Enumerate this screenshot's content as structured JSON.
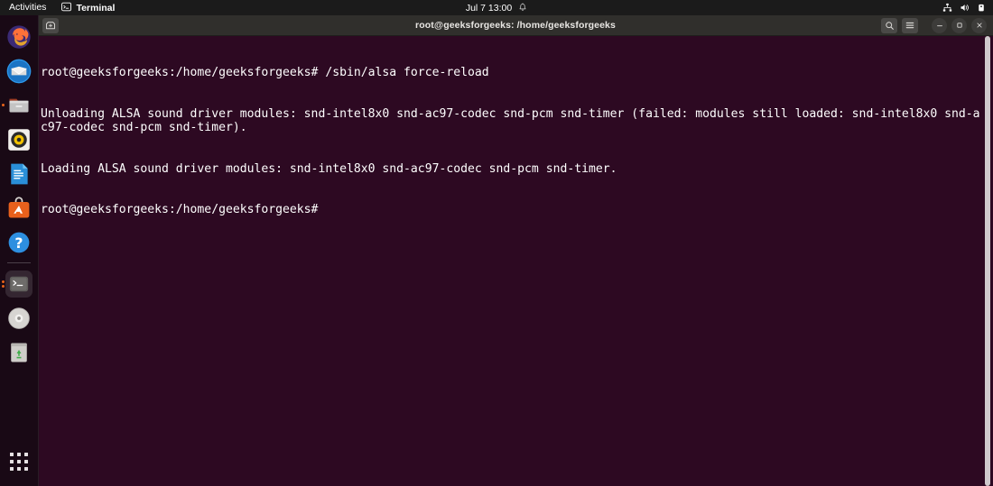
{
  "topbar": {
    "activities": "Activities",
    "app_name": "Terminal",
    "app_icon": "terminal-icon",
    "clock": "Jul 7  13:00",
    "notification_icon": "bell-icon",
    "status_icons": [
      "network-icon",
      "volume-icon",
      "power-icon"
    ]
  },
  "dock": {
    "items": [
      {
        "name": "firefox",
        "label": "Firefox",
        "running": false,
        "active": false
      },
      {
        "name": "thunderbird",
        "label": "Thunderbird Mail",
        "running": false,
        "active": false
      },
      {
        "name": "files",
        "label": "Files",
        "running": true,
        "active": false
      },
      {
        "name": "rhythmbox",
        "label": "Rhythmbox",
        "running": false,
        "active": false
      },
      {
        "name": "libreoffice-writer",
        "label": "LibreOffice Writer",
        "running": false,
        "active": false
      },
      {
        "name": "ubuntu-software",
        "label": "Ubuntu Software",
        "running": false,
        "active": false
      },
      {
        "name": "help",
        "label": "Help",
        "running": false,
        "active": false
      },
      {
        "name": "terminal",
        "label": "Terminal",
        "running": true,
        "active": true
      },
      {
        "name": "disk-image",
        "label": "CD/DVD Disc",
        "running": false,
        "active": false
      },
      {
        "name": "trash",
        "label": "Trash",
        "running": false,
        "active": false
      }
    ],
    "show_apps_label": "Show Applications"
  },
  "window": {
    "title": "root@geeksforgeeks: /home/geeksforgeeks",
    "new_tab_icon": "new-tab-icon",
    "search_icon": "search-icon",
    "menu_icon": "hamburger-menu-icon",
    "minimize_icon": "minimize-icon",
    "maximize_icon": "maximize-icon",
    "close_icon": "close-icon"
  },
  "terminal": {
    "background": "#2d0922",
    "foreground": "#ffffff",
    "lines": [
      "root@geeksforgeeks:/home/geeksforgeeks# /sbin/alsa force-reload",
      "Unloading ALSA sound driver modules: snd-intel8x0 snd-ac97-codec snd-pcm snd-timer (failed: modules still loaded: snd-intel8x0 snd-ac97-codec snd-pcm snd-timer).",
      "Loading ALSA sound driver modules: snd-intel8x0 snd-ac97-codec snd-pcm snd-timer.",
      "root@geeksforgeeks:/home/geeksforgeeks# "
    ]
  }
}
